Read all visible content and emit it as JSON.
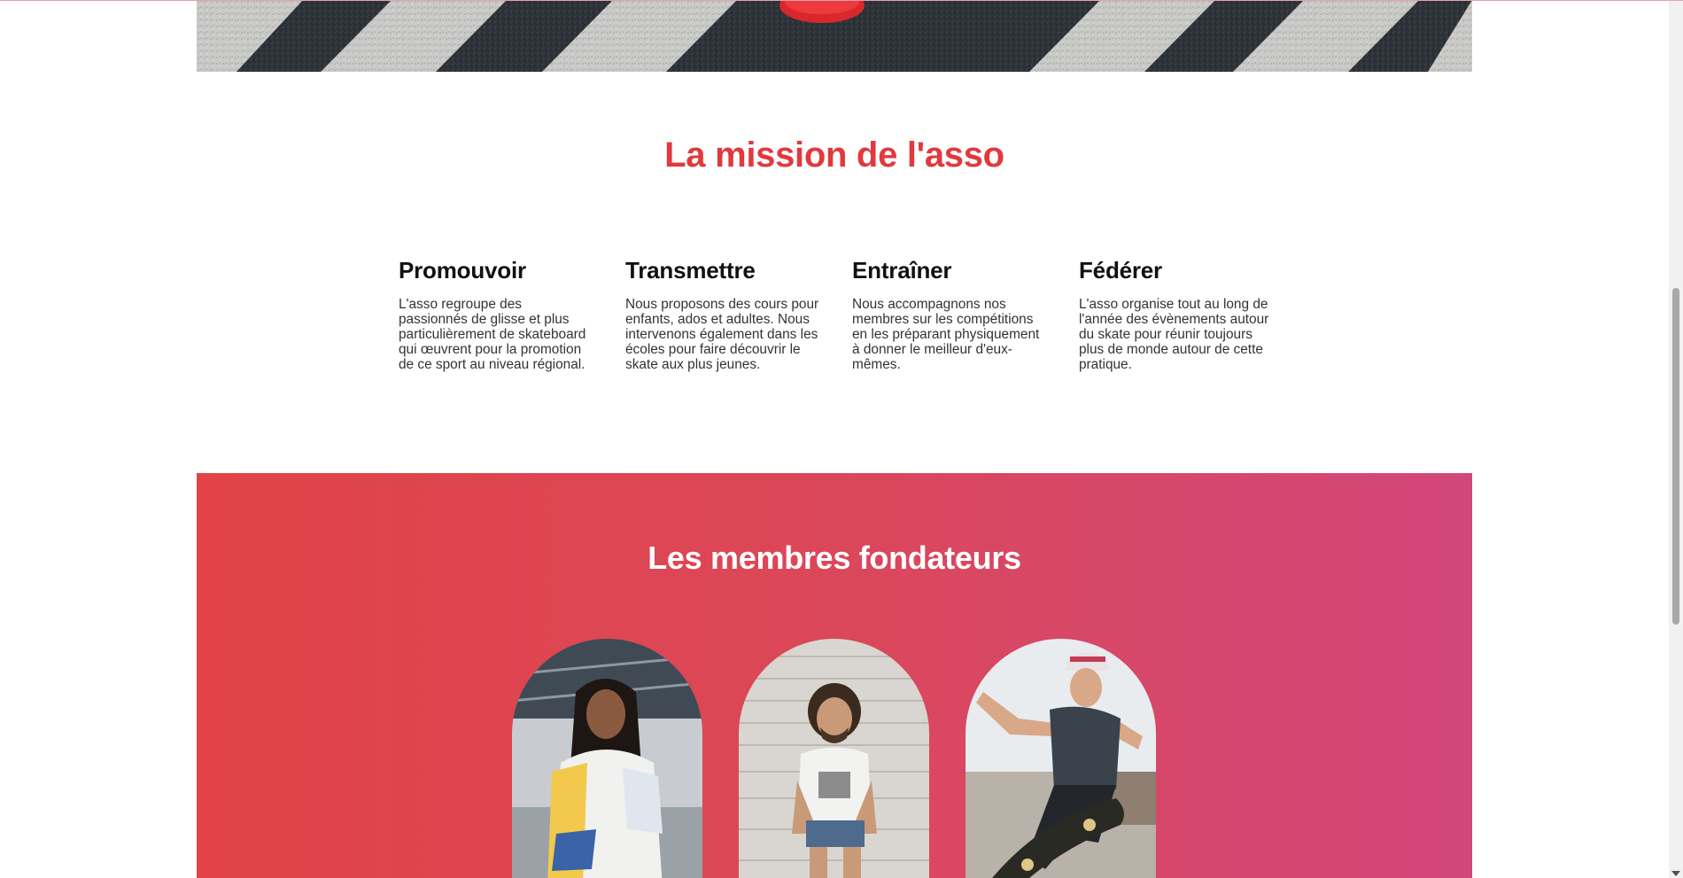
{
  "mission": {
    "title": "La mission de l'asso",
    "pillars": [
      {
        "title": "Promouvoir",
        "text": "L'asso regroupe des passionnés de glisse et plus particulièrement de skateboard qui œuvrent pour la promotion de ce sport au niveau régional."
      },
      {
        "title": "Transmettre",
        "text": "Nous proposons des cours pour enfants, ados et adultes. Nous intervenons également dans les écoles pour faire découvrir le skate aux plus jeunes."
      },
      {
        "title": "Entraîner",
        "text": "Nous accompagnons nos membres sur les compétitions en les préparant physiquement à donner le meilleur d'eux-mêmes."
      },
      {
        "title": "Fédérer",
        "text": "L'asso organise tout au long de l'année des évènements autour du skate pour réunir toujours plus de monde autour de cette pratique."
      }
    ]
  },
  "founders": {
    "title": "Les membres fondateurs"
  },
  "colors": {
    "accent_red": "#e0393e",
    "gradient_start": "#e14346",
    "gradient_end": "#d1477a"
  }
}
